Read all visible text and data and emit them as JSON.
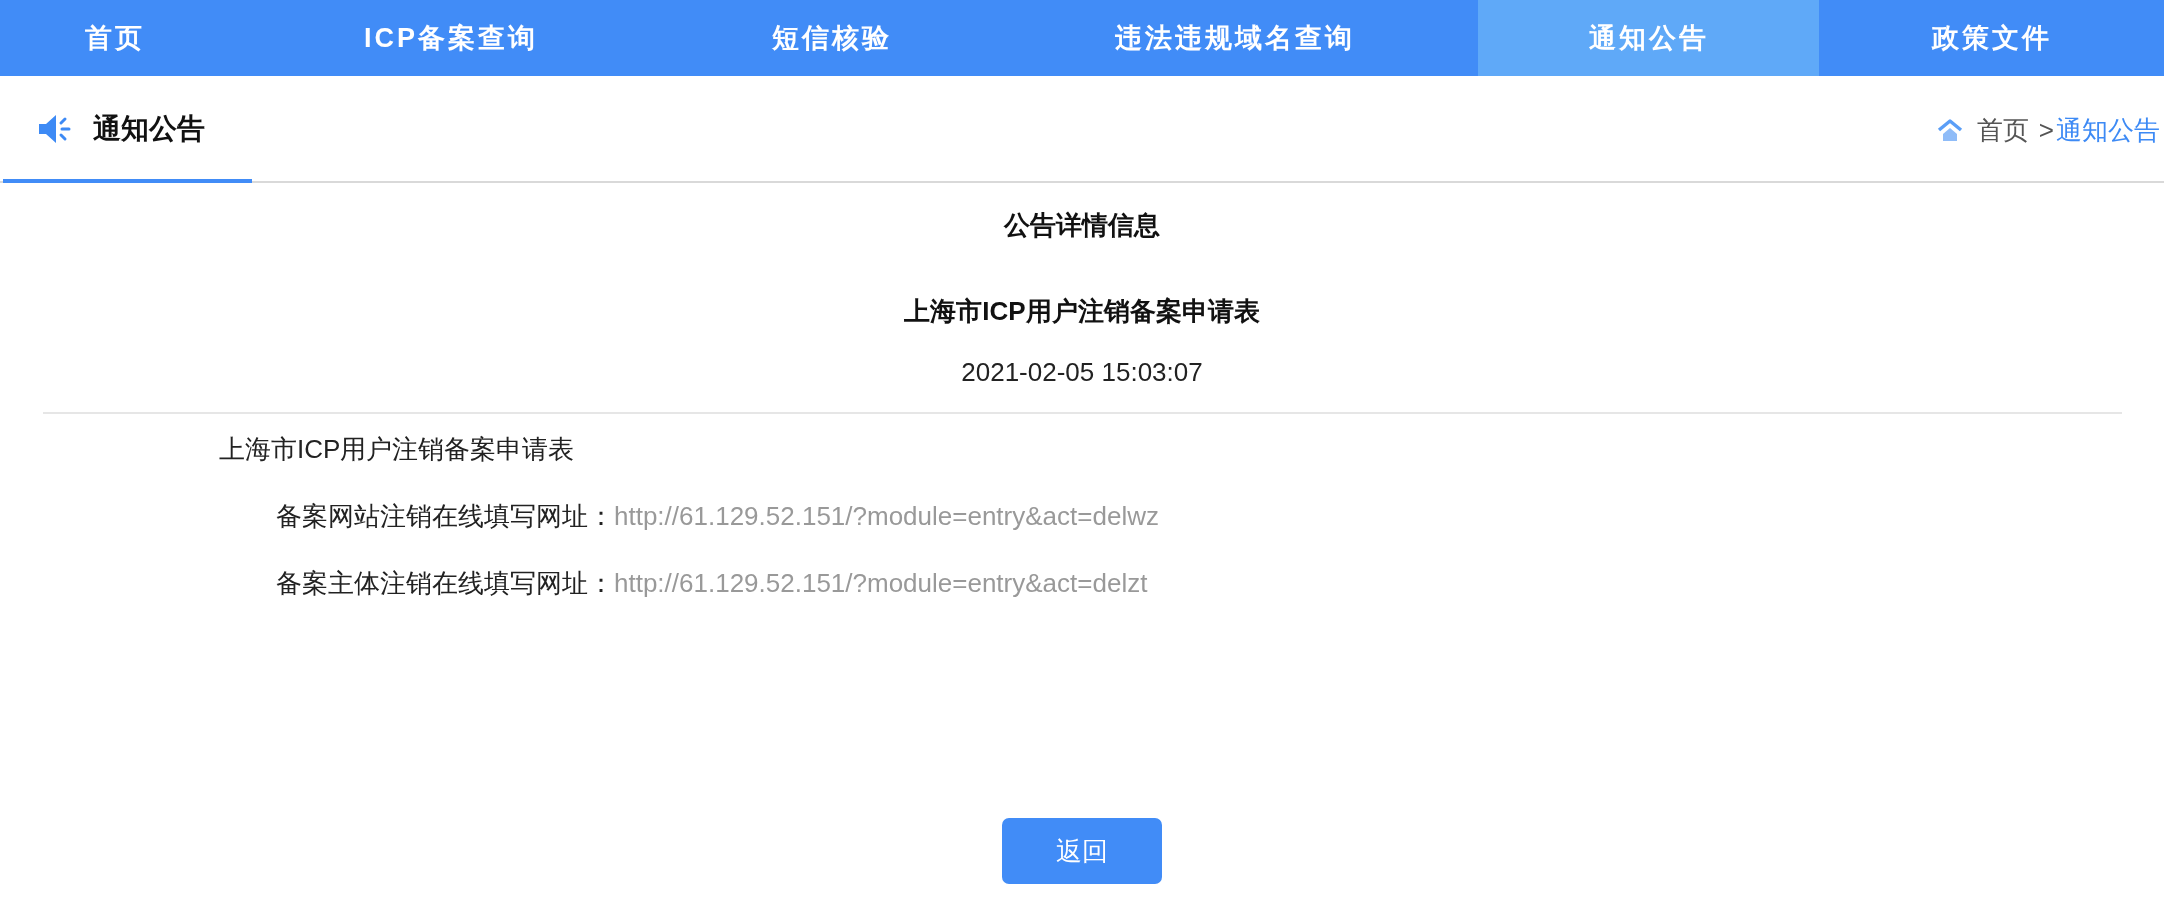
{
  "nav": {
    "items": [
      {
        "label": "首页",
        "selected": false
      },
      {
        "label": "ICP备案查询",
        "selected": false
      },
      {
        "label": "短信核验",
        "selected": false
      },
      {
        "label": "违法违规域名查询",
        "selected": false
      },
      {
        "label": "通知公告",
        "selected": true
      },
      {
        "label": "政策文件",
        "selected": false
      }
    ]
  },
  "header": {
    "title": "通知公告",
    "breadcrumb": {
      "separator": ">",
      "items": [
        {
          "label": "首页",
          "current": false
        },
        {
          "label": "通知公告",
          "current": true
        }
      ]
    }
  },
  "notice": {
    "heading": "公告详情信息",
    "title": "上海市ICP用户注销备案申请表",
    "date": "2021-02-05 15:03:07",
    "intro": "上海市ICP用户注销备案申请表",
    "entries": [
      {
        "label": "备案网站注销在线填写网址：",
        "url": "http://61.129.52.151/?module=entry&act=delwz"
      },
      {
        "label": "备案主体注销在线填写网址：",
        "url": "http://61.129.52.151/?module=entry&act=delzt"
      }
    ]
  },
  "back_button": {
    "label": "返回"
  }
}
